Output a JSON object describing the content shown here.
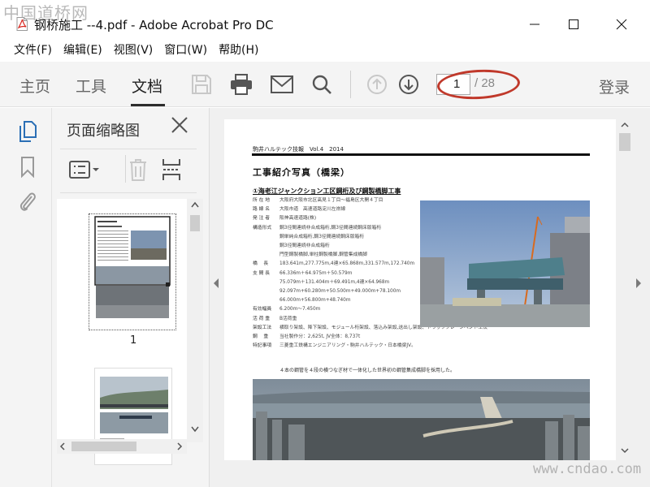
{
  "watermark_top": "中国道桥网",
  "watermark_bottom": "www.cndao.com",
  "window": {
    "title": "钢桥施工 --4.pdf - Adobe Acrobat Pro DC"
  },
  "menu": [
    "文件(F)",
    "编辑(E)",
    "视图(V)",
    "窗口(W)",
    "帮助(H)"
  ],
  "toolbar": {
    "tabs": [
      "主页",
      "工具",
      "文档"
    ],
    "active_tab": "文档",
    "page_current": "1",
    "page_total": "/ 28",
    "login": "登录"
  },
  "thumbnails": {
    "title": "页面缩略图",
    "page_labels": [
      "1"
    ]
  },
  "document": {
    "header": "駒井ハルテック技報　Vol.4　2014",
    "title": "工事紹介写真（橋梁）",
    "section": "①海老江ジャンクション工区鋼桁及び鋼製橋脚工事",
    "specs": [
      {
        "key": "所 在 地",
        "value": "大阪府大阪市北区高見１丁目～福島区大開４丁目"
      },
      {
        "key": "路 線 名",
        "value": "大阪市道　高速道路淀川左岸線"
      },
      {
        "key": "発 注 者",
        "value": "阪神高速道路(株)"
      },
      {
        "key": "構造形式",
        "value": "鋼3径間連続非合成箱桁,鋼3径間連続鋼床版箱桁"
      },
      {
        "key": "",
        "value": "鋼単純合成箱桁,鋼3径間連続鋼床版箱桁"
      },
      {
        "key": "",
        "value": "鋼3径間連続非合成箱桁"
      },
      {
        "key": "",
        "value": "門型鋼製橋脚,単柱鋼製橋脚,鋼管集成橋脚"
      },
      {
        "key": "橋　 長",
        "value": "183.641m,277.775m,4連×65.868m,331.577m,172.740m"
      },
      {
        "key": "支 間 長",
        "value": "66.336m＋64.975m＋50.579m"
      },
      {
        "key": "",
        "value": "75.079m＋131.404m＋69.491m,4連×64.968m"
      },
      {
        "key": "",
        "value": "92.097m+60.280m+50.500m+49.000m+78.100m"
      },
      {
        "key": "",
        "value": "66.000m+56.800m+48.740m"
      },
      {
        "key": "有効幅員",
        "value": "6.200m～7.450m"
      },
      {
        "key": "活 荷 重",
        "value": "B活荷重"
      },
      {
        "key": "架設工法",
        "value": "横取り架設、降下架設、モジュール桁架設、落込み架設,送出し架設、トラッククレーンベント工法"
      },
      {
        "key": "鋼　 重",
        "value": "当社製作分：2,625t, JV全体：8,737t"
      },
      {
        "key": "特記事項",
        "value": "三菱重工鉄構エンジニアリング・駒井ハルテック・日本橋梁JV。"
      }
    ],
    "note": "４本の鋼管を４段の横つなぎ材で一体化した世界初の鋼管集成橋脚を採用した。"
  },
  "colors": {
    "accent": "#2b6fb5",
    "highlight_ellipse": "#c0392b",
    "toolbar_bg": "#f4f4f4",
    "acrobat_red": "#d7261e"
  }
}
